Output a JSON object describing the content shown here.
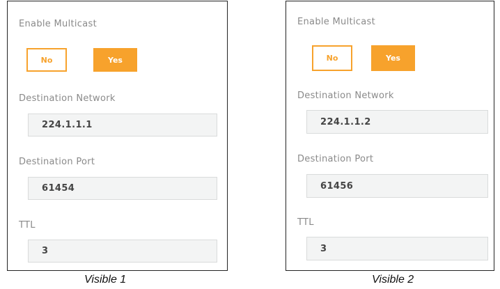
{
  "accent_color": "#f7a22c",
  "panels": [
    {
      "enable_multicast_label": "Enable Multicast",
      "no_label": "No",
      "yes_label": "Yes",
      "selected": "Yes",
      "destination_network_label": "Destination Network",
      "destination_network_value": "224.1.1.1",
      "destination_port_label": "Destination Port",
      "destination_port_value": "61454",
      "ttl_label": "TTL",
      "ttl_value": "3",
      "caption": "Visible 1"
    },
    {
      "enable_multicast_label": "Enable Multicast",
      "no_label": "No",
      "yes_label": "Yes",
      "selected": "Yes",
      "destination_network_label": "Destination Network",
      "destination_network_value": "224.1.1.2",
      "destination_port_label": "Destination Port",
      "destination_port_value": "61456",
      "ttl_label": "TTL",
      "ttl_value": "3",
      "caption": "Visible 2"
    }
  ]
}
